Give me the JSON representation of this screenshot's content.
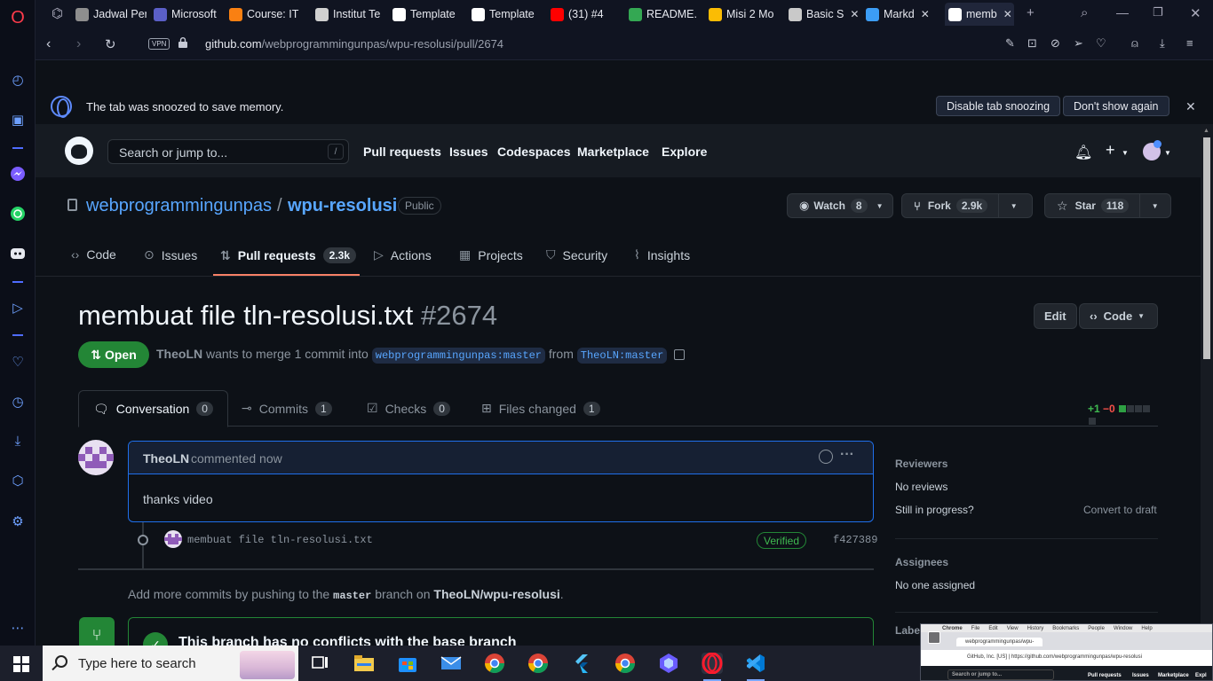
{
  "browser": {
    "tabs": [
      {
        "label": "Jadwal Per",
        "icon": "sheet-icon",
        "color": "#8e8e8e"
      },
      {
        "label": "Microsoft",
        "icon": "teams-icon",
        "color": "#5b5fc7"
      },
      {
        "label": "Course: IT",
        "icon": "moodle-icon",
        "color": "#f98012"
      },
      {
        "label": "Institut Te",
        "icon": "institute-icon",
        "color": "#d0d0d0"
      },
      {
        "label": "Template",
        "icon": "github-icon",
        "color": "#ffffff"
      },
      {
        "label": "Template",
        "icon": "github-icon",
        "color": "#ffffff"
      },
      {
        "label": "(31) #4",
        "icon": "youtube-icon",
        "color": "#ff0000"
      },
      {
        "label": "README.",
        "icon": "drive-icon",
        "color": "#34a853"
      },
      {
        "label": "Misi 2 Mo",
        "icon": "drive-icon",
        "color": "#fbbc04"
      },
      {
        "label": "Basic S",
        "icon": "w3-icon",
        "color": "#c9c9c9"
      },
      {
        "label": "Markd",
        "icon": "vscode-icon",
        "color": "#3c9df5"
      },
      {
        "label": "memb",
        "icon": "github-icon",
        "color": "#ffffff"
      }
    ],
    "url_host": "github.com",
    "url_path": "/webprogrammingunpas/wpu-resolusi/pull/2674",
    "vpn_label": "VPN"
  },
  "snooze": {
    "message": "The tab was snoozed to save memory.",
    "disable_label": "Disable tab snoozing",
    "dont_show_label": "Don't show again"
  },
  "gh_header": {
    "search_placeholder": "Search or jump to...",
    "slash": "/",
    "nav": [
      "Pull requests",
      "Issues",
      "Codespaces",
      "Marketplace",
      "Explore"
    ]
  },
  "repo": {
    "owner": "webprogrammingunpas",
    "separator": "/",
    "name": "wpu-resolusi",
    "visibility": "Public",
    "watch_label": "Watch",
    "watch_count": "8",
    "fork_label": "Fork",
    "fork_count": "2.9k",
    "star_label": "Star",
    "star_count": "118"
  },
  "repo_tabs": [
    {
      "label": "Code",
      "icon": "code-icon"
    },
    {
      "label": "Issues",
      "icon": "issue-icon"
    },
    {
      "label": "Pull requests",
      "icon": "pull-request-icon",
      "count": "2.3k"
    },
    {
      "label": "Actions",
      "icon": "play-icon"
    },
    {
      "label": "Projects",
      "icon": "table-icon"
    },
    {
      "label": "Security",
      "icon": "shield-icon"
    },
    {
      "label": "Insights",
      "icon": "graph-icon"
    }
  ],
  "pr": {
    "title": "membuat file tln-resolusi.txt",
    "number": "#2674",
    "edit_label": "Edit",
    "code_label": "Code",
    "state": "Open",
    "author": "TheoLN",
    "meta_text": "wants to merge 1 commit into",
    "base_branch": "webprogrammingunpas:master",
    "from_text": "from",
    "head_branch": "TheoLN:master"
  },
  "pr_tabs": [
    {
      "label": "Conversation",
      "count": "0"
    },
    {
      "label": "Commits",
      "count": "1"
    },
    {
      "label": "Checks",
      "count": "0"
    },
    {
      "label": "Files changed",
      "count": "1"
    }
  ],
  "diffstat": {
    "additions": "+1",
    "deletions": "−0"
  },
  "comment": {
    "author": "TheoLN",
    "when": "commented now",
    "body": "thanks video"
  },
  "commit": {
    "message": "membuat file tln-resolusi.txt",
    "verified": "Verified",
    "sha": "f427389"
  },
  "hint": {
    "prefix": "Add more commits by pushing to the",
    "branch": "master",
    "middle": "branch on",
    "repo": "TheoLN/wpu-resolusi",
    "suffix": "."
  },
  "merge": {
    "title": "This branch has no conflicts with the base branch"
  },
  "sidebar": {
    "reviewers_title": "Reviewers",
    "reviewers_value": "No reviews",
    "progress_text": "Still in progress?",
    "convert_label": "Convert to draft",
    "assignees_title": "Assignees",
    "assignees_value": "No one assigned",
    "labels_title": "Labels"
  },
  "taskbar": {
    "search_placeholder": "Type here to search"
  },
  "pip": {
    "menu": [
      "Chrome",
      "File",
      "Edit",
      "View",
      "History",
      "Bookmarks",
      "People",
      "Window",
      "Help"
    ],
    "tab_title": "webprogrammingunpas/wpu-",
    "url": "GitHub, Inc. [US] | https://github.com/webprogrammingunpas/wpu-resolusi",
    "search": "Search or jump to...",
    "nav": [
      "Pull requests",
      "Issues",
      "Marketplace",
      "Expl"
    ]
  }
}
